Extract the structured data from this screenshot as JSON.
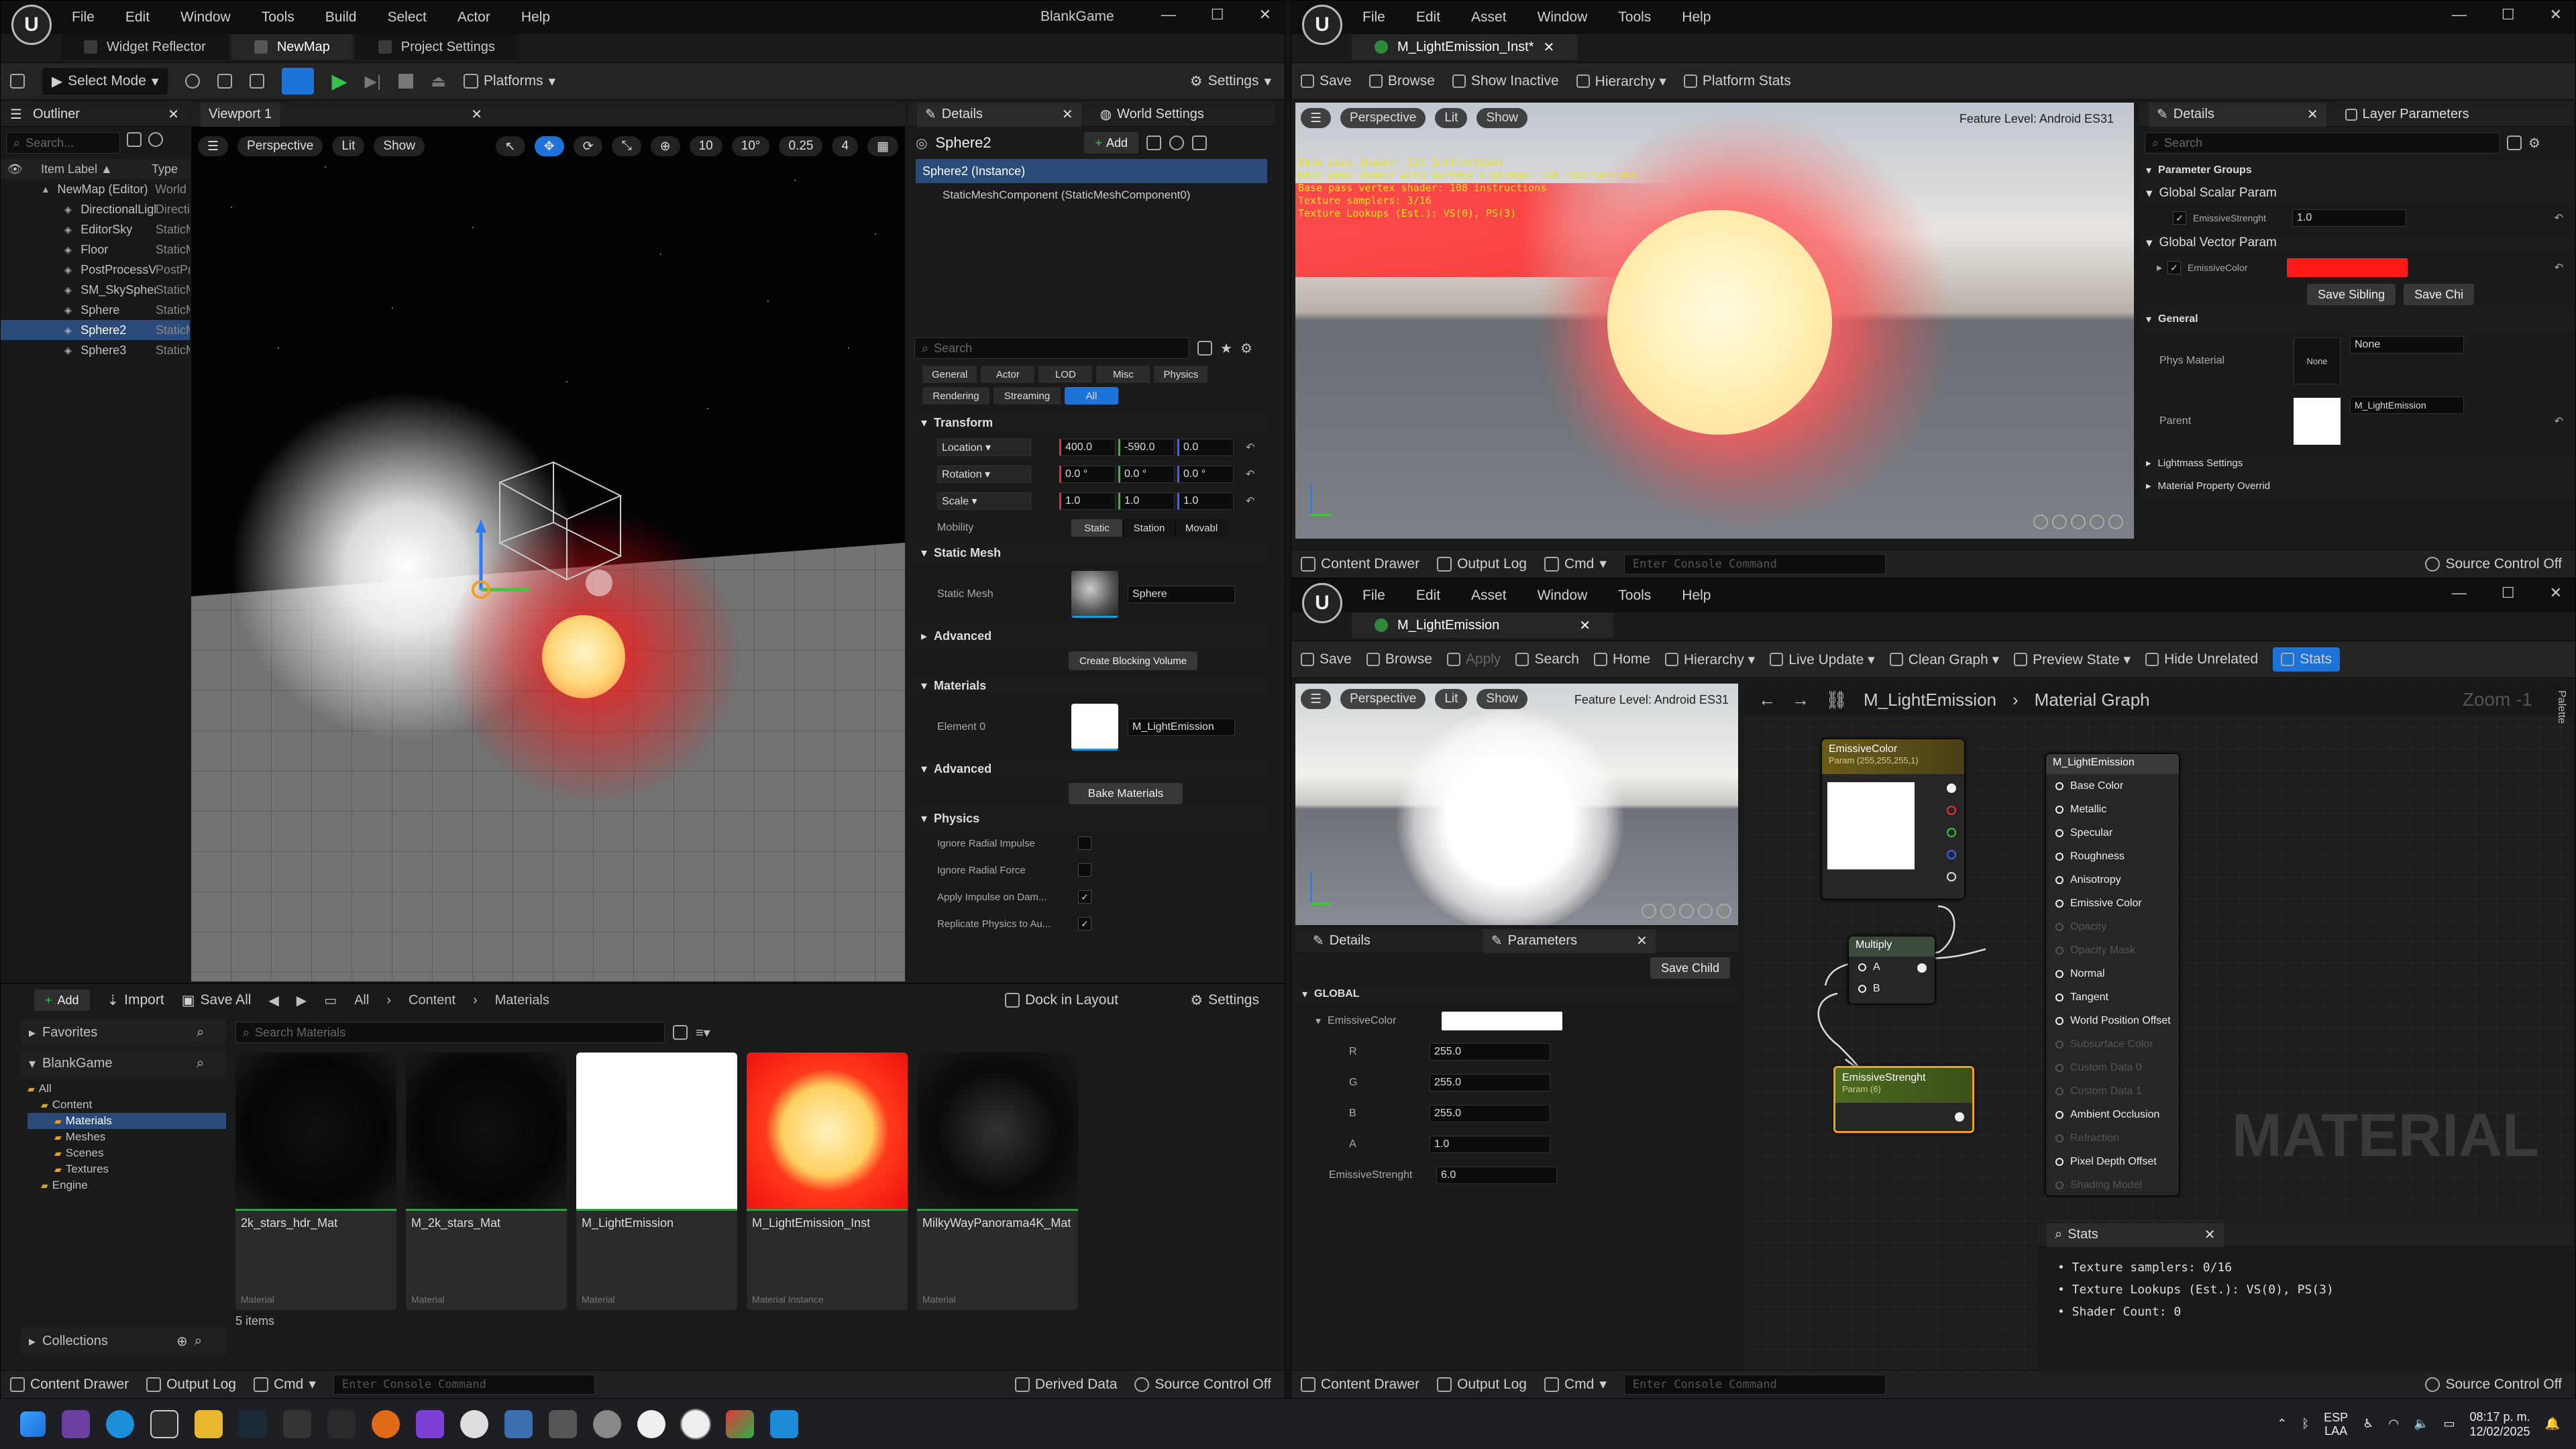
{
  "main_window": {
    "menu": [
      "File",
      "Edit",
      "Window",
      "Tools",
      "Build",
      "Select",
      "Actor",
      "Help"
    ],
    "project_name": "BlankGame",
    "tabs": [
      "Widget Reflector",
      "NewMap",
      "Project Settings"
    ],
    "toolbar": {
      "select_mode": "Select Mode",
      "platforms": "Platforms",
      "settings": "Settings"
    },
    "outliner": {
      "title": "Outliner",
      "search_placeholder": "Search...",
      "col_label": "Item Label ▲",
      "col_type": "Type",
      "items": [
        {
          "label": "NewMap (Editor)",
          "type": "World"
        },
        {
          "label": "DirectionalLight",
          "type": "Directional"
        },
        {
          "label": "EditorSky",
          "type": "StaticMesh"
        },
        {
          "label": "Floor",
          "type": "StaticMesh"
        },
        {
          "label": "PostProcessVolume",
          "type": "PostProcess"
        },
        {
          "label": "SM_SkySphere",
          "type": "StaticMesh"
        },
        {
          "label": "Sphere",
          "type": "StaticMesh"
        },
        {
          "label": "Sphere2",
          "type": "StaticMesh"
        },
        {
          "label": "Sphere3",
          "type": "StaticMesh"
        }
      ]
    },
    "viewport": {
      "tab": "Viewport 1",
      "perspective": "Perspective",
      "lit": "Lit",
      "show": "Show",
      "grid": "10",
      "rot": "10°",
      "scale": "0.25",
      "cam": "4"
    },
    "details": {
      "tab": "Details",
      "tab2": "World Settings",
      "actor": "Sphere2",
      "add": "Add",
      "instance": "Sphere2 (Instance)",
      "component": "StaticMeshComponent (StaticMeshComponent0)",
      "search_placeholder": "Search",
      "filters": [
        "General",
        "Actor",
        "LOD",
        "Misc",
        "Physics",
        "Rendering",
        "Streaming",
        "All"
      ],
      "transform": "Transform",
      "location": {
        "label": "Location",
        "x": "400.0",
        "y": "-590.0",
        "z": "0.0"
      },
      "rotation": {
        "label": "Rotation",
        "x": "0.0 °",
        "y": "0.0 °",
        "z": "0.0 °"
      },
      "scale": {
        "label": "Scale",
        "x": "1.0",
        "y": "1.0",
        "z": "1.0"
      },
      "mobility": {
        "label": "Mobility",
        "opts": [
          "Static",
          "Station",
          "Movabl"
        ]
      },
      "static_mesh_section": "Static Mesh",
      "static_mesh_label": "Static Mesh",
      "static_mesh_value": "Sphere",
      "advanced": "Advanced",
      "create_blocking": "Create Blocking Volume",
      "materials": "Materials",
      "element0": "Element 0",
      "element0_value": "M_LightEmission",
      "advanced2": "Advanced",
      "bake": "Bake Materials",
      "physics": "Physics",
      "physics_props": [
        "Ignore Radial Impulse",
        "Ignore Radial Force",
        "Apply Impulse on Dam...",
        "Replicate Physics to Au..."
      ]
    },
    "content_browser": {
      "add": "Add",
      "import": "Import",
      "save_all": "Save All",
      "crumbs": [
        "All",
        "Content",
        "Materials"
      ],
      "dock": "Dock in Layout",
      "settings": "Settings",
      "favorites": "Favorites",
      "project": "BlankGame",
      "tree": [
        "All",
        "Content",
        "Materials",
        "Meshes",
        "Scenes",
        "Textures",
        "Engine"
      ],
      "search_placeholder": "Search Materials",
      "collections": "Collections",
      "count": "5 items",
      "assets": [
        {
          "name": "2k_stars_hdr_Mat",
          "type": "Material"
        },
        {
          "name": "M_2k_stars_Mat",
          "type": "Material"
        },
        {
          "name": "M_LightEmission",
          "type": "Material"
        },
        {
          "name": "M_LightEmission_Inst",
          "type": "Material Instance"
        },
        {
          "name": "MilkyWayPanorama4K_Mat",
          "type": "Material"
        }
      ]
    },
    "status": {
      "content_drawer": "Content Drawer",
      "output_log": "Output Log",
      "cmd": "Cmd",
      "console": "Enter Console Command",
      "derived": "Derived Data",
      "source": "Source Control Off"
    }
  },
  "inst_window": {
    "menu": [
      "File",
      "Edit",
      "Asset",
      "Window",
      "Tools",
      "Help"
    ],
    "tab": "M_LightEmission_Inst*",
    "toolbar": [
      "Save",
      "Browse",
      "Show Inactive",
      "Hierarchy",
      "Platform Stats"
    ],
    "viewport": {
      "perspective": "Perspective",
      "lit": "Lit",
      "show": "Show",
      "feature": "Feature Level:  Android ES31",
      "stats": [
        "Base pass shader: 124 instructions",
        "Base pass shader with Surface Lightmap: 150 instructions",
        "Base pass vertex shader: 108 instructions",
        "Texture samplers: 3/16",
        "Texture Lookups (Est.): VS(0), PS(3)"
      ]
    },
    "details": {
      "tab": "Details",
      "tab2": "Layer Parameters",
      "search": "Search",
      "param_groups": "Parameter Groups",
      "scalar": "Global Scalar Param",
      "scalar_name": "EmissiveStrenght",
      "scalar_value": "1.0",
      "vector": "Global Vector Param",
      "vector_name": "EmissiveColor",
      "vector_color": "#ff1a1a",
      "save_sibling": "Save Sibling",
      "save_child": "Save Chi",
      "general": "General",
      "phys_material": "Phys Material",
      "phys_none": "None",
      "phys_value": "None",
      "parent": "Parent",
      "parent_value": "M_LightEmission",
      "lightmass": "Lightmass Settings",
      "mpo": "Material Property Overrid"
    },
    "status": {
      "content_drawer": "Content Drawer",
      "output_log": "Output Log",
      "cmd": "Cmd",
      "console": "Enter Console Command",
      "source": "Source Control Off"
    }
  },
  "mat_window": {
    "menu": [
      "File",
      "Edit",
      "Asset",
      "Window",
      "Tools",
      "Help"
    ],
    "tab": "M_LightEmission",
    "toolbar": [
      "Save",
      "Browse",
      "Apply",
      "Search",
      "Home",
      "Hierarchy",
      "Live Update",
      "Clean Graph",
      "Preview State",
      "Hide Unrelated",
      "Stats"
    ],
    "viewport": {
      "perspective": "Perspective",
      "lit": "Lit",
      "show": "Show",
      "feature": "Feature Level:  Android ES31"
    },
    "graph": {
      "crumb1": "M_LightEmission",
      "crumb2": "Material Graph",
      "zoom": "Zoom -1",
      "watermark": "MATERIAL",
      "palette": "Palette"
    },
    "nodes": {
      "color_title": "EmissiveColor",
      "color_sub": "Param (255,255,255,1)",
      "multiply": "Multiply",
      "pin_a": "A",
      "pin_b": "B",
      "strength_title": "EmissiveStrenght",
      "strength_sub": "Param (6)",
      "result_title": "M_LightEmission",
      "result_pins": [
        {
          "label": "Base Color",
          "on": true
        },
        {
          "label": "Metallic",
          "on": true
        },
        {
          "label": "Specular",
          "on": true
        },
        {
          "label": "Roughness",
          "on": true
        },
        {
          "label": "Anisotropy",
          "on": true
        },
        {
          "label": "Emissive Color",
          "on": true
        },
        {
          "label": "Opacity",
          "on": false
        },
        {
          "label": "Opacity Mask",
          "on": false
        },
        {
          "label": "Normal",
          "on": true
        },
        {
          "label": "Tangent",
          "on": true
        },
        {
          "label": "World Position Offset",
          "on": true
        },
        {
          "label": "Subsurface Color",
          "on": false
        },
        {
          "label": "Custom Data 0",
          "on": false
        },
        {
          "label": "Custom Data 1",
          "on": false
        },
        {
          "label": "Ambient Occlusion",
          "on": true
        },
        {
          "label": "Refraction",
          "on": false
        },
        {
          "label": "Pixel Depth Offset",
          "on": true
        },
        {
          "label": "Shading Model",
          "on": false
        }
      ]
    },
    "params": {
      "tab": "Details",
      "tab2": "Parameters",
      "save_child": "Save Child",
      "global": "GLOBAL",
      "color_name": "EmissiveColor",
      "r": "255.0",
      "g": "255.0",
      "b": "255.0",
      "a": "1.0",
      "strength_name": "EmissiveStrenght",
      "strength": "6.0"
    },
    "stats": {
      "tab": "Stats",
      "lines": [
        "• Texture samplers: 0/16",
        "• Texture Lookups (Est.): VS(0), PS(3)",
        "• Shader Count: 0"
      ]
    },
    "status": {
      "content_drawer": "Content Drawer",
      "output_log": "Output Log",
      "cmd": "Cmd",
      "console": "Enter Console Command",
      "source": "Source Control Off"
    }
  },
  "taskbar": {
    "lang1": "ESP",
    "lang2": "LAA",
    "time": "08:17 p. m.",
    "date": "12/02/2025"
  }
}
